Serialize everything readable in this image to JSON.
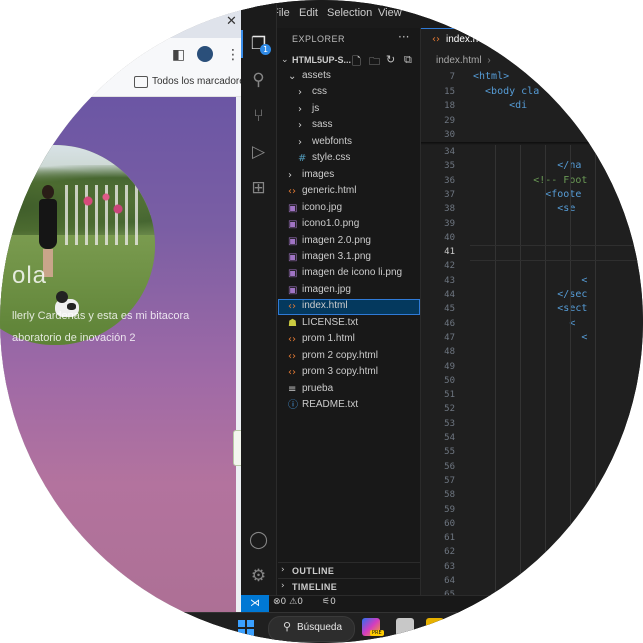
{
  "browser": {
    "bookmarks_label": "Todos los marcadores",
    "page": {
      "heading": "ola",
      "line1": "llerly Cardenas y esta es mi bitacora",
      "line2": "aboratorio de inovación 2"
    }
  },
  "vscode": {
    "menu": [
      "File",
      "Edit",
      "Selection",
      "View"
    ],
    "explorer_title": "EXPLORER",
    "project_name": "HTML5UP-S...",
    "tree": [
      {
        "label": "assets",
        "icon": "chevron-down-icon",
        "indent": 1
      },
      {
        "label": "css",
        "icon": "chevron-right-icon",
        "indent": 2
      },
      {
        "label": "js",
        "icon": "chevron-right-icon",
        "indent": 2
      },
      {
        "label": "sass",
        "icon": "chevron-right-icon",
        "indent": 2
      },
      {
        "label": "webfonts",
        "icon": "chevron-right-icon",
        "indent": 2
      },
      {
        "label": "style.css",
        "icon": "css-file-icon",
        "indent": 2
      },
      {
        "label": "images",
        "icon": "chevron-right-icon",
        "indent": 1
      },
      {
        "label": "generic.html",
        "icon": "html-file-icon",
        "indent": 1
      },
      {
        "label": "icono.jpg",
        "icon": "image-file-icon",
        "indent": 1
      },
      {
        "label": "icono1.0.png",
        "icon": "image-file-icon",
        "indent": 1
      },
      {
        "label": "imagen 2.0.png",
        "icon": "image-file-icon",
        "indent": 1
      },
      {
        "label": "imagen 3.1.png",
        "icon": "image-file-icon",
        "indent": 1
      },
      {
        "label": "imagen de icono li.png",
        "icon": "image-file-icon",
        "indent": 1
      },
      {
        "label": "imagen.jpg",
        "icon": "image-file-icon",
        "indent": 1
      },
      {
        "label": "index.html",
        "icon": "html-file-icon",
        "indent": 1,
        "selected": true
      },
      {
        "label": "LICENSE.txt",
        "icon": "license-file-icon",
        "indent": 1
      },
      {
        "label": "prom 1.html",
        "icon": "html-file-icon",
        "indent": 1
      },
      {
        "label": "prom 2 copy.html",
        "icon": "html-file-icon",
        "indent": 1
      },
      {
        "label": "prom 3 copy.html",
        "icon": "html-file-icon",
        "indent": 1
      },
      {
        "label": "prueba",
        "icon": "text-file-icon",
        "indent": 1
      },
      {
        "label": "README.txt",
        "icon": "info-file-icon",
        "indent": 1
      }
    ],
    "sections": {
      "outline": "OUTLINE",
      "timeline": "TIMELINE"
    },
    "tab_label": "index.h",
    "breadcrumb": "index.html",
    "code_lines": [
      {
        "n": "7",
        "text": "<html>"
      },
      {
        "n": "15",
        "text": "  <body cla"
      },
      {
        "n": "18",
        "text": "      <di"
      },
      {
        "n": "29",
        "text": ""
      },
      {
        "n": "30",
        "text": ""
      },
      {
        "n": "34",
        "text": ""
      },
      {
        "n": "35",
        "text": "              </na"
      },
      {
        "n": "36",
        "text": "          <!-- Foot"
      },
      {
        "n": "37",
        "text": "            <foote"
      },
      {
        "n": "38",
        "text": "              <se"
      },
      {
        "n": "39",
        "text": ""
      },
      {
        "n": "40",
        "text": ""
      },
      {
        "n": "41",
        "text": ""
      },
      {
        "n": "42",
        "text": ""
      },
      {
        "n": "43",
        "text": "                  <"
      },
      {
        "n": "44",
        "text": "              </sec"
      },
      {
        "n": "45",
        "text": "              <sect"
      },
      {
        "n": "46",
        "text": "                <"
      },
      {
        "n": "47",
        "text": "                  <"
      },
      {
        "n": "48",
        "text": ""
      },
      {
        "n": "49",
        "text": ""
      },
      {
        "n": "50",
        "text": ""
      },
      {
        "n": "51",
        "text": ""
      },
      {
        "n": "52",
        "text": ""
      },
      {
        "n": "53",
        "text": ""
      },
      {
        "n": "54",
        "text": ""
      },
      {
        "n": "55",
        "text": ""
      },
      {
        "n": "56",
        "text": ""
      },
      {
        "n": "57",
        "text": ""
      },
      {
        "n": "58",
        "text": ""
      },
      {
        "n": "59",
        "text": ""
      },
      {
        "n": "60",
        "text": ""
      },
      {
        "n": "61",
        "text": ""
      },
      {
        "n": "62",
        "text": ""
      },
      {
        "n": "63",
        "text": ""
      },
      {
        "n": "64",
        "text": ""
      },
      {
        "n": "65",
        "text": ""
      }
    ],
    "status": {
      "errors": "0",
      "warnings": "0",
      "ports": "0"
    }
  },
  "taskbar": {
    "search_label": "Búsqueda",
    "app_badge": "PRE"
  },
  "colors": {
    "vscode_accent": "#0078d4",
    "selection": "#04395e",
    "browser_gradient_top": "#6b56a4",
    "browser_gradient_bottom": "#ad7095"
  }
}
